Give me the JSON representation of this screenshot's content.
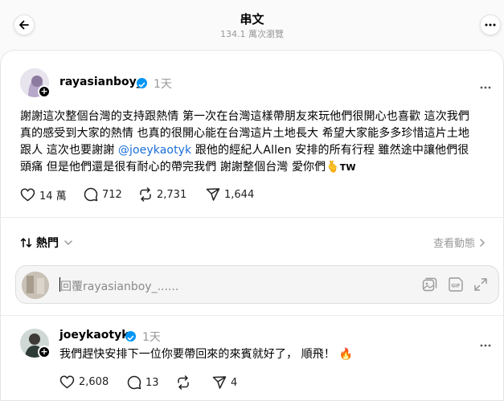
{
  "header": {
    "title": "串文",
    "views": "134.1 萬次瀏覽"
  },
  "post": {
    "username": "rayasianboy_",
    "time": "1天",
    "text_before_mention": "謝謝這次整個台灣的支持跟熱情 第一次在台灣這樣帶朋友來玩他們很開心也喜歡 這次我們真的感受到大家的熱情 也真的很開心能在台灣這片土地長大 希望大家能多多珍惜這片土地跟人 這次也要謝謝 ",
    "mention": "@joeykaotyk",
    "text_after_mention": " 跟他的經紀人Allen 安排的所有行程 雖然途中讓他們很頭痛 但是他們還是很有耐心的帶完我們 謝謝整個台灣 愛你們",
    "emoji": "🫰",
    "flag": "TW",
    "likes": "14 萬",
    "comments": "712",
    "reposts": "2,731",
    "shares": "1,644"
  },
  "sort": {
    "label": "熱門",
    "view_activity": "查看動態"
  },
  "reply_box": {
    "placeholder": "回覆rayasianboy_......"
  },
  "reply": {
    "username": "joeykaotyk",
    "time": "1天",
    "text": "我們趕快安排下一位你要帶回來的來賓就好了， 順飛！",
    "emoji": "🔥",
    "likes": "2,608",
    "comments": "13",
    "reposts": "",
    "shares": "4"
  },
  "colors": {
    "verified": "#0095f6",
    "mention": "#1a6ed8",
    "muted": "#999999"
  },
  "icons": [
    "back-arrow-icon",
    "more-icon",
    "verified-icon",
    "heart-icon",
    "comment-icon",
    "repost-icon",
    "share-icon",
    "sort-icon",
    "chevron-down-icon",
    "chevron-right-icon",
    "image-icon",
    "gif-icon",
    "expand-icon",
    "plus-icon"
  ]
}
